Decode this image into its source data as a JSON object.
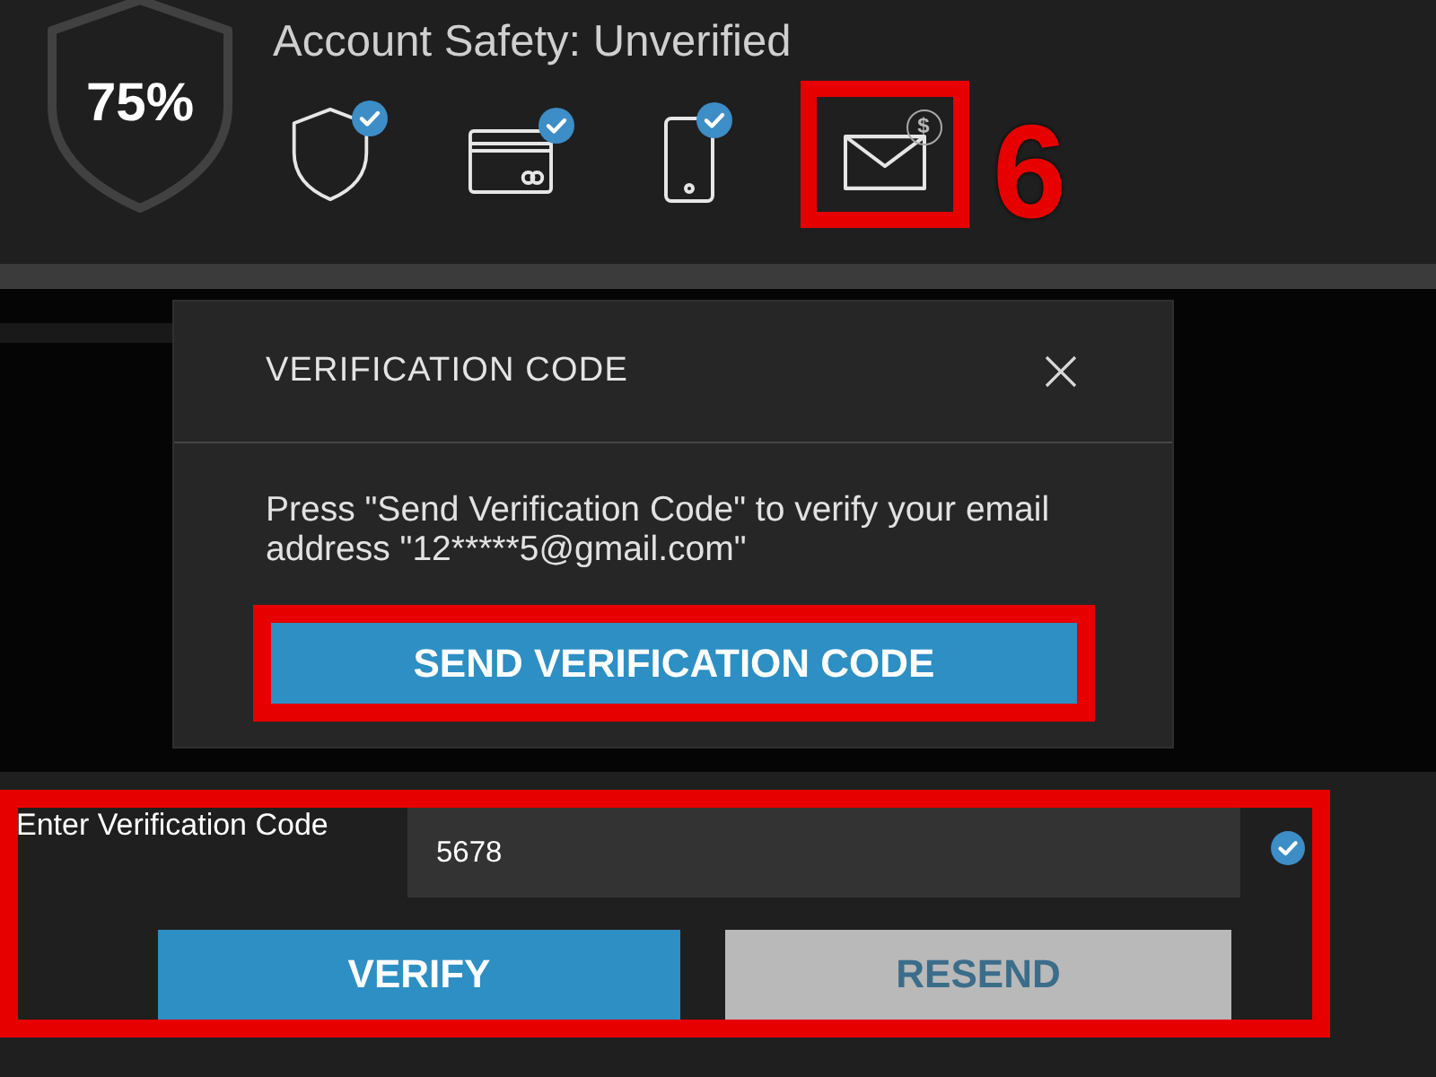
{
  "header": {
    "score": "75%",
    "title": "Account Safety: Unverified",
    "items": [
      {
        "kind": "shield",
        "verified": true,
        "highlighted": false
      },
      {
        "kind": "card",
        "verified": true,
        "highlighted": false
      },
      {
        "kind": "phone",
        "verified": true,
        "highlighted": false
      },
      {
        "kind": "email",
        "verified": false,
        "badge": "$",
        "highlighted": true
      }
    ],
    "step": "6"
  },
  "dialog": {
    "title": "VERIFICATION CODE",
    "message": "Press \"Send Verification Code\" to verify your email address \"12*****5@gmail.com\"",
    "send_button": {
      "label": "SEND VERIFICATION CODE",
      "highlighted": true
    }
  },
  "code_form": {
    "label": "Enter Verification Code",
    "value": "5678",
    "valid": true,
    "highlighted": true,
    "buttons": [
      {
        "kind": "primary",
        "label": "VERIFY"
      },
      {
        "kind": "secondary",
        "label": "RESEND"
      }
    ]
  }
}
